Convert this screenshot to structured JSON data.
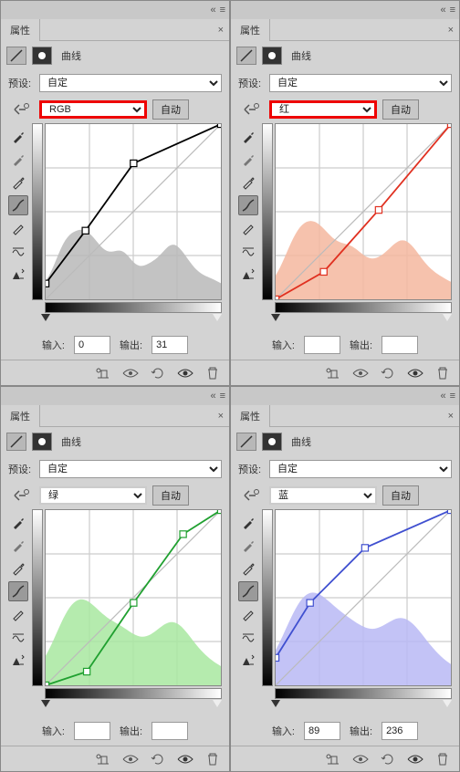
{
  "common": {
    "panel_title": "属性",
    "section_label": "曲线",
    "preset_label": "预设:",
    "preset_value": "自定",
    "auto_label": "自动",
    "input_label": "输入:",
    "output_label": "输出:"
  },
  "panels": [
    {
      "channel": "RGB",
      "highlighted": true,
      "input_val": "0",
      "output_val": "31",
      "hist": "gray",
      "curve_pts": [
        [
          0,
          23
        ],
        [
          58,
          100
        ],
        [
          128,
          198
        ],
        [
          255,
          255
        ]
      ]
    },
    {
      "channel": "红",
      "highlighted": true,
      "input_val": "",
      "output_val": "",
      "hist": "r",
      "curve_pts": [
        [
          0,
          0
        ],
        [
          70,
          40
        ],
        [
          150,
          130
        ],
        [
          255,
          255
        ]
      ]
    },
    {
      "channel": "绿",
      "highlighted": false,
      "input_val": "",
      "output_val": "",
      "hist": "g",
      "curve_pts": [
        [
          0,
          0
        ],
        [
          60,
          20
        ],
        [
          128,
          120
        ],
        [
          200,
          220
        ],
        [
          255,
          255
        ]
      ]
    },
    {
      "channel": "蓝",
      "highlighted": false,
      "input_val": "89",
      "output_val": "236",
      "hist": "b",
      "curve_pts": [
        [
          0,
          40
        ],
        [
          50,
          120
        ],
        [
          130,
          200
        ],
        [
          255,
          255
        ]
      ]
    }
  ],
  "icons": {
    "collapse": "«",
    "menu": "≡",
    "close": "×"
  }
}
